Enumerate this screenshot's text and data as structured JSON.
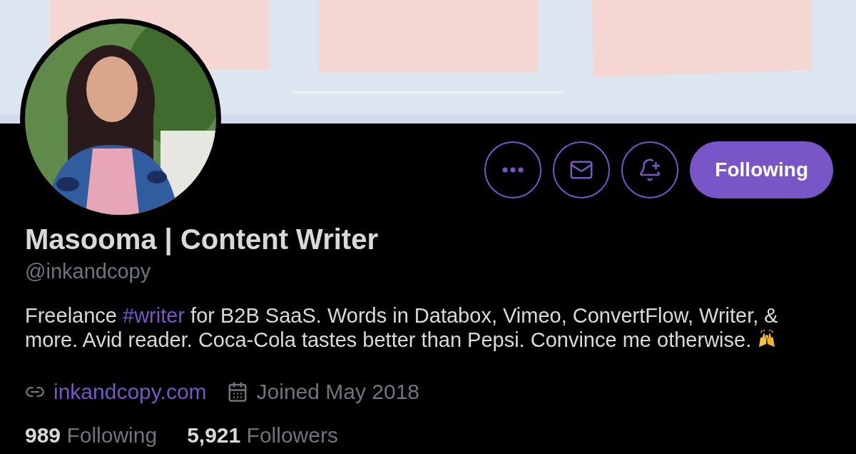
{
  "actions": [
    {
      "kind": "more"
    },
    {
      "kind": "message"
    },
    {
      "kind": "notify"
    }
  ],
  "follow_button": {
    "label": "Following",
    "selected": true
  },
  "name": "Masooma | Content Writer",
  "handle": "@inkandcopy",
  "bio": [
    {
      "kind": "text",
      "text": "Freelance "
    },
    {
      "kind": "hashtag",
      "text": "#writer"
    },
    {
      "kind": "text",
      "text": " for B2B SaaS. Words in Databox, Vimeo, ConvertFlow, Writer, & more. Avid reader. Coca-Cola tastes better than Pepsi. Convince me otherwise. "
    },
    {
      "kind": "emoji"
    }
  ],
  "website": "inkandcopy.com",
  "joined": "Joined May 2018",
  "stats": [
    {
      "count": "989",
      "label": "Following"
    },
    {
      "count": "5,921",
      "label": "Followers"
    }
  ]
}
